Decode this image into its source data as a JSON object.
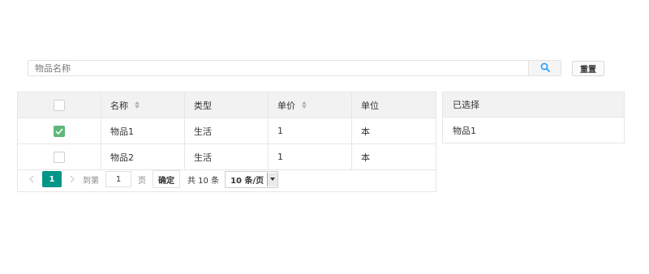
{
  "search": {
    "placeholder": "物品名称",
    "value": ""
  },
  "buttons": {
    "reset": "重置"
  },
  "table": {
    "columns": [
      {
        "label": "名称",
        "sortable": true
      },
      {
        "label": "类型",
        "sortable": false
      },
      {
        "label": "单价",
        "sortable": true
      },
      {
        "label": "单位",
        "sortable": false
      }
    ],
    "rows": [
      {
        "checked": true,
        "name": "物品1",
        "type": "生活",
        "price": "1",
        "unit": "本"
      },
      {
        "checked": false,
        "name": "物品2",
        "type": "生活",
        "price": "1",
        "unit": "本"
      }
    ]
  },
  "pagination": {
    "current_page": "1",
    "goto_prefix": "到第",
    "goto_value": "1",
    "goto_suffix": "页",
    "confirm": "确定",
    "total": "共 10 条",
    "page_size": "10 条/页"
  },
  "selected_panel": {
    "title": "已选择",
    "items": [
      "物品1"
    ]
  },
  "colors": {
    "accent": "#009688",
    "checkbox_checked": "#5fb878",
    "search_icon": "#1e9fff"
  }
}
